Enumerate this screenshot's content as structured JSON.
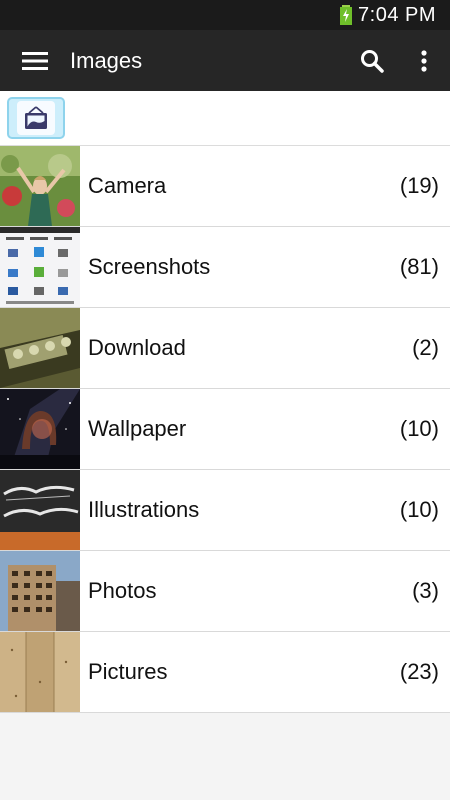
{
  "status": {
    "time": "7:04 PM"
  },
  "header": {
    "title": "Images"
  },
  "icons": {
    "menu": "hamburger-menu-icon",
    "search": "search-icon",
    "overflow": "more-vert-icon",
    "home": "folder-image-home-icon"
  },
  "albums": [
    {
      "name": "Camera",
      "count": "(19)"
    },
    {
      "name": "Screenshots",
      "count": "(81)"
    },
    {
      "name": "Download",
      "count": "(2)"
    },
    {
      "name": "Wallpaper",
      "count": "(10)"
    },
    {
      "name": "Illustrations",
      "count": "(10)"
    },
    {
      "name": "Photos",
      "count": "(3)"
    },
    {
      "name": "Pictures",
      "count": "(23)"
    }
  ],
  "colors": {
    "action_bar": "#262626",
    "status_bar": "#1b1b1b",
    "chip_border": "#8ed3ec"
  }
}
